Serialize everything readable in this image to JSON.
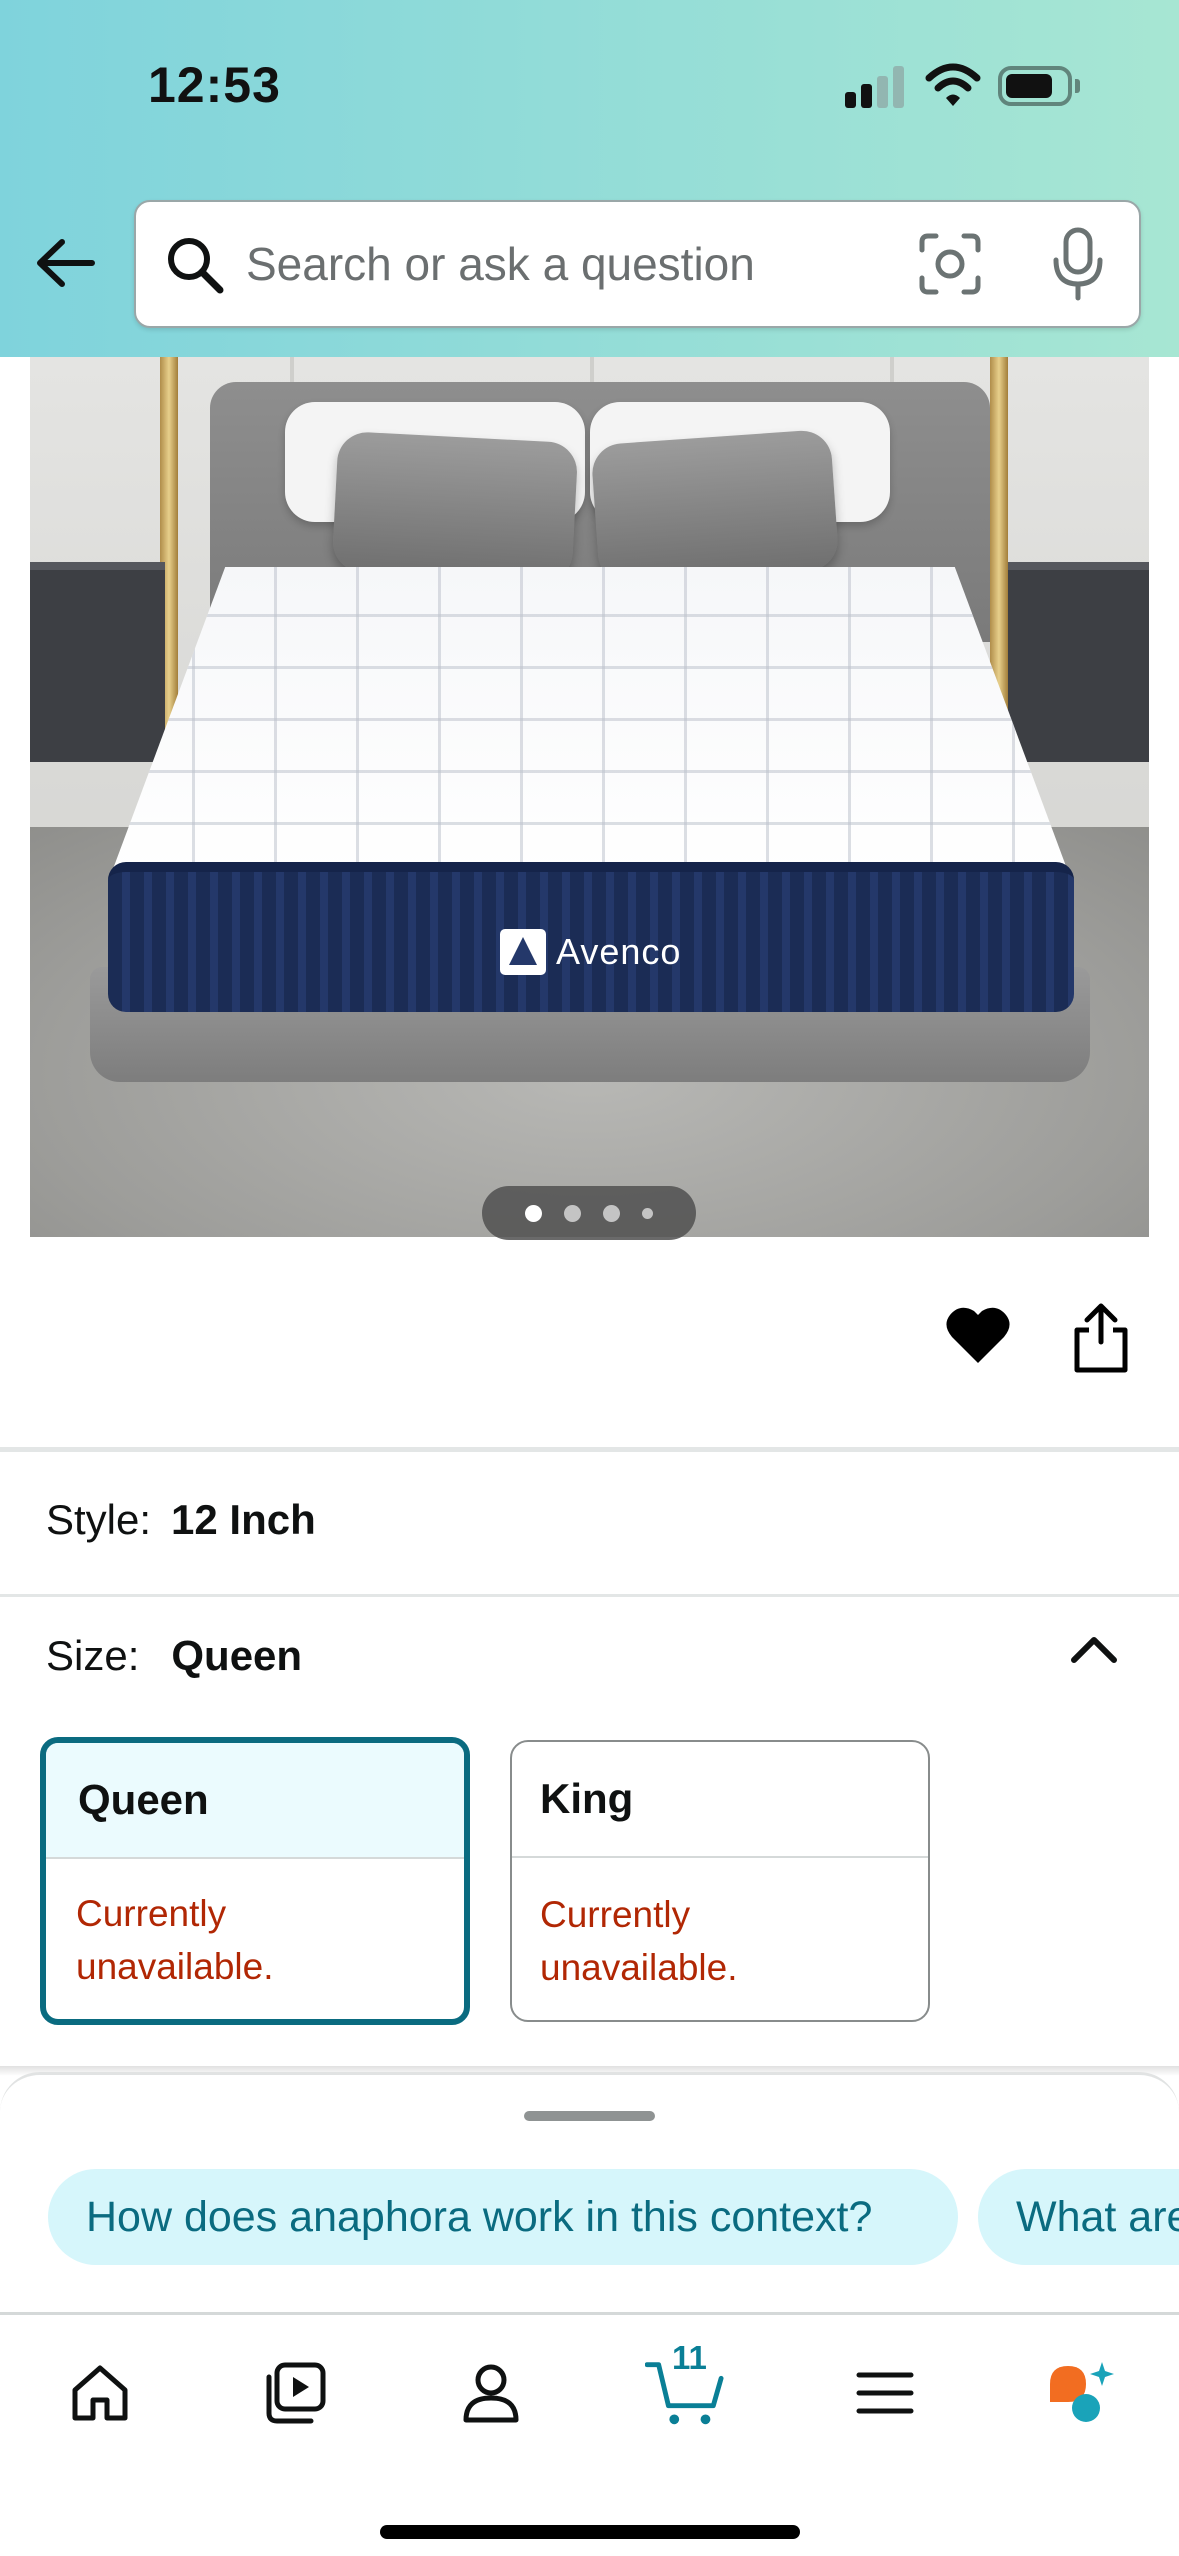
{
  "status_bar": {
    "time": "12:53"
  },
  "search": {
    "placeholder": "Search or ask a question"
  },
  "product_image": {
    "brand_text": "Avenco",
    "carousel": {
      "total": 4,
      "active_index": 0
    }
  },
  "actions": {
    "favorite": "heart-icon",
    "share": "share-icon"
  },
  "style": {
    "label": "Style:",
    "value": "12 Inch"
  },
  "size": {
    "label": "Size:",
    "value": "Queen",
    "options": [
      {
        "name": "Queen",
        "status": "Currently\nunavailable.",
        "selected": true
      },
      {
        "name": "King",
        "status": "Currently\nunavailable.",
        "selected": false
      }
    ]
  },
  "suggestions": [
    "How does anaphora work in this context?",
    "What are"
  ],
  "tabbar": {
    "items": [
      "home-icon",
      "video-icon",
      "account-icon",
      "cart-icon",
      "menu-icon",
      "rufus-icon"
    ],
    "cart_count": "11"
  },
  "colors": {
    "accent": "#0A6B80",
    "unavailable": "#B12704",
    "chip_bg": "#D6F6FB",
    "selected_card_bg": "#EBFBFE"
  }
}
